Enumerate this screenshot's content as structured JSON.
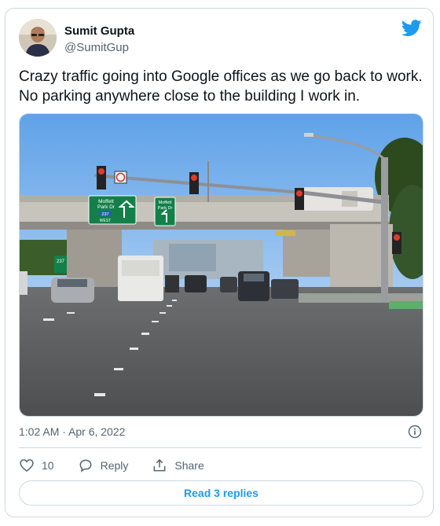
{
  "author": {
    "name": "Sumit Gupta",
    "handle": "@SumitGup"
  },
  "tweet": {
    "text": "Crazy traffic going into Google offices as we go back to work. No parking anywhere close to the building I work in.",
    "timestamp": "1:02 AM · Apr 6, 2022"
  },
  "photo": {
    "sign_left_line1": "Moffett",
    "sign_left_line2": "Park Dr",
    "sign_left_route": "237",
    "sign_left_dir": "WEST",
    "sign_right_line1": "Moffett",
    "sign_right_line2": "Park Dr",
    "small_sign_route": "237"
  },
  "actions": {
    "likes": "10",
    "reply_label": "Reply",
    "share_label": "Share"
  },
  "read_replies_label": "Read 3 replies",
  "colors": {
    "accent": "#1d9bf0",
    "muted": "#536471",
    "border": "#cfd9de"
  }
}
